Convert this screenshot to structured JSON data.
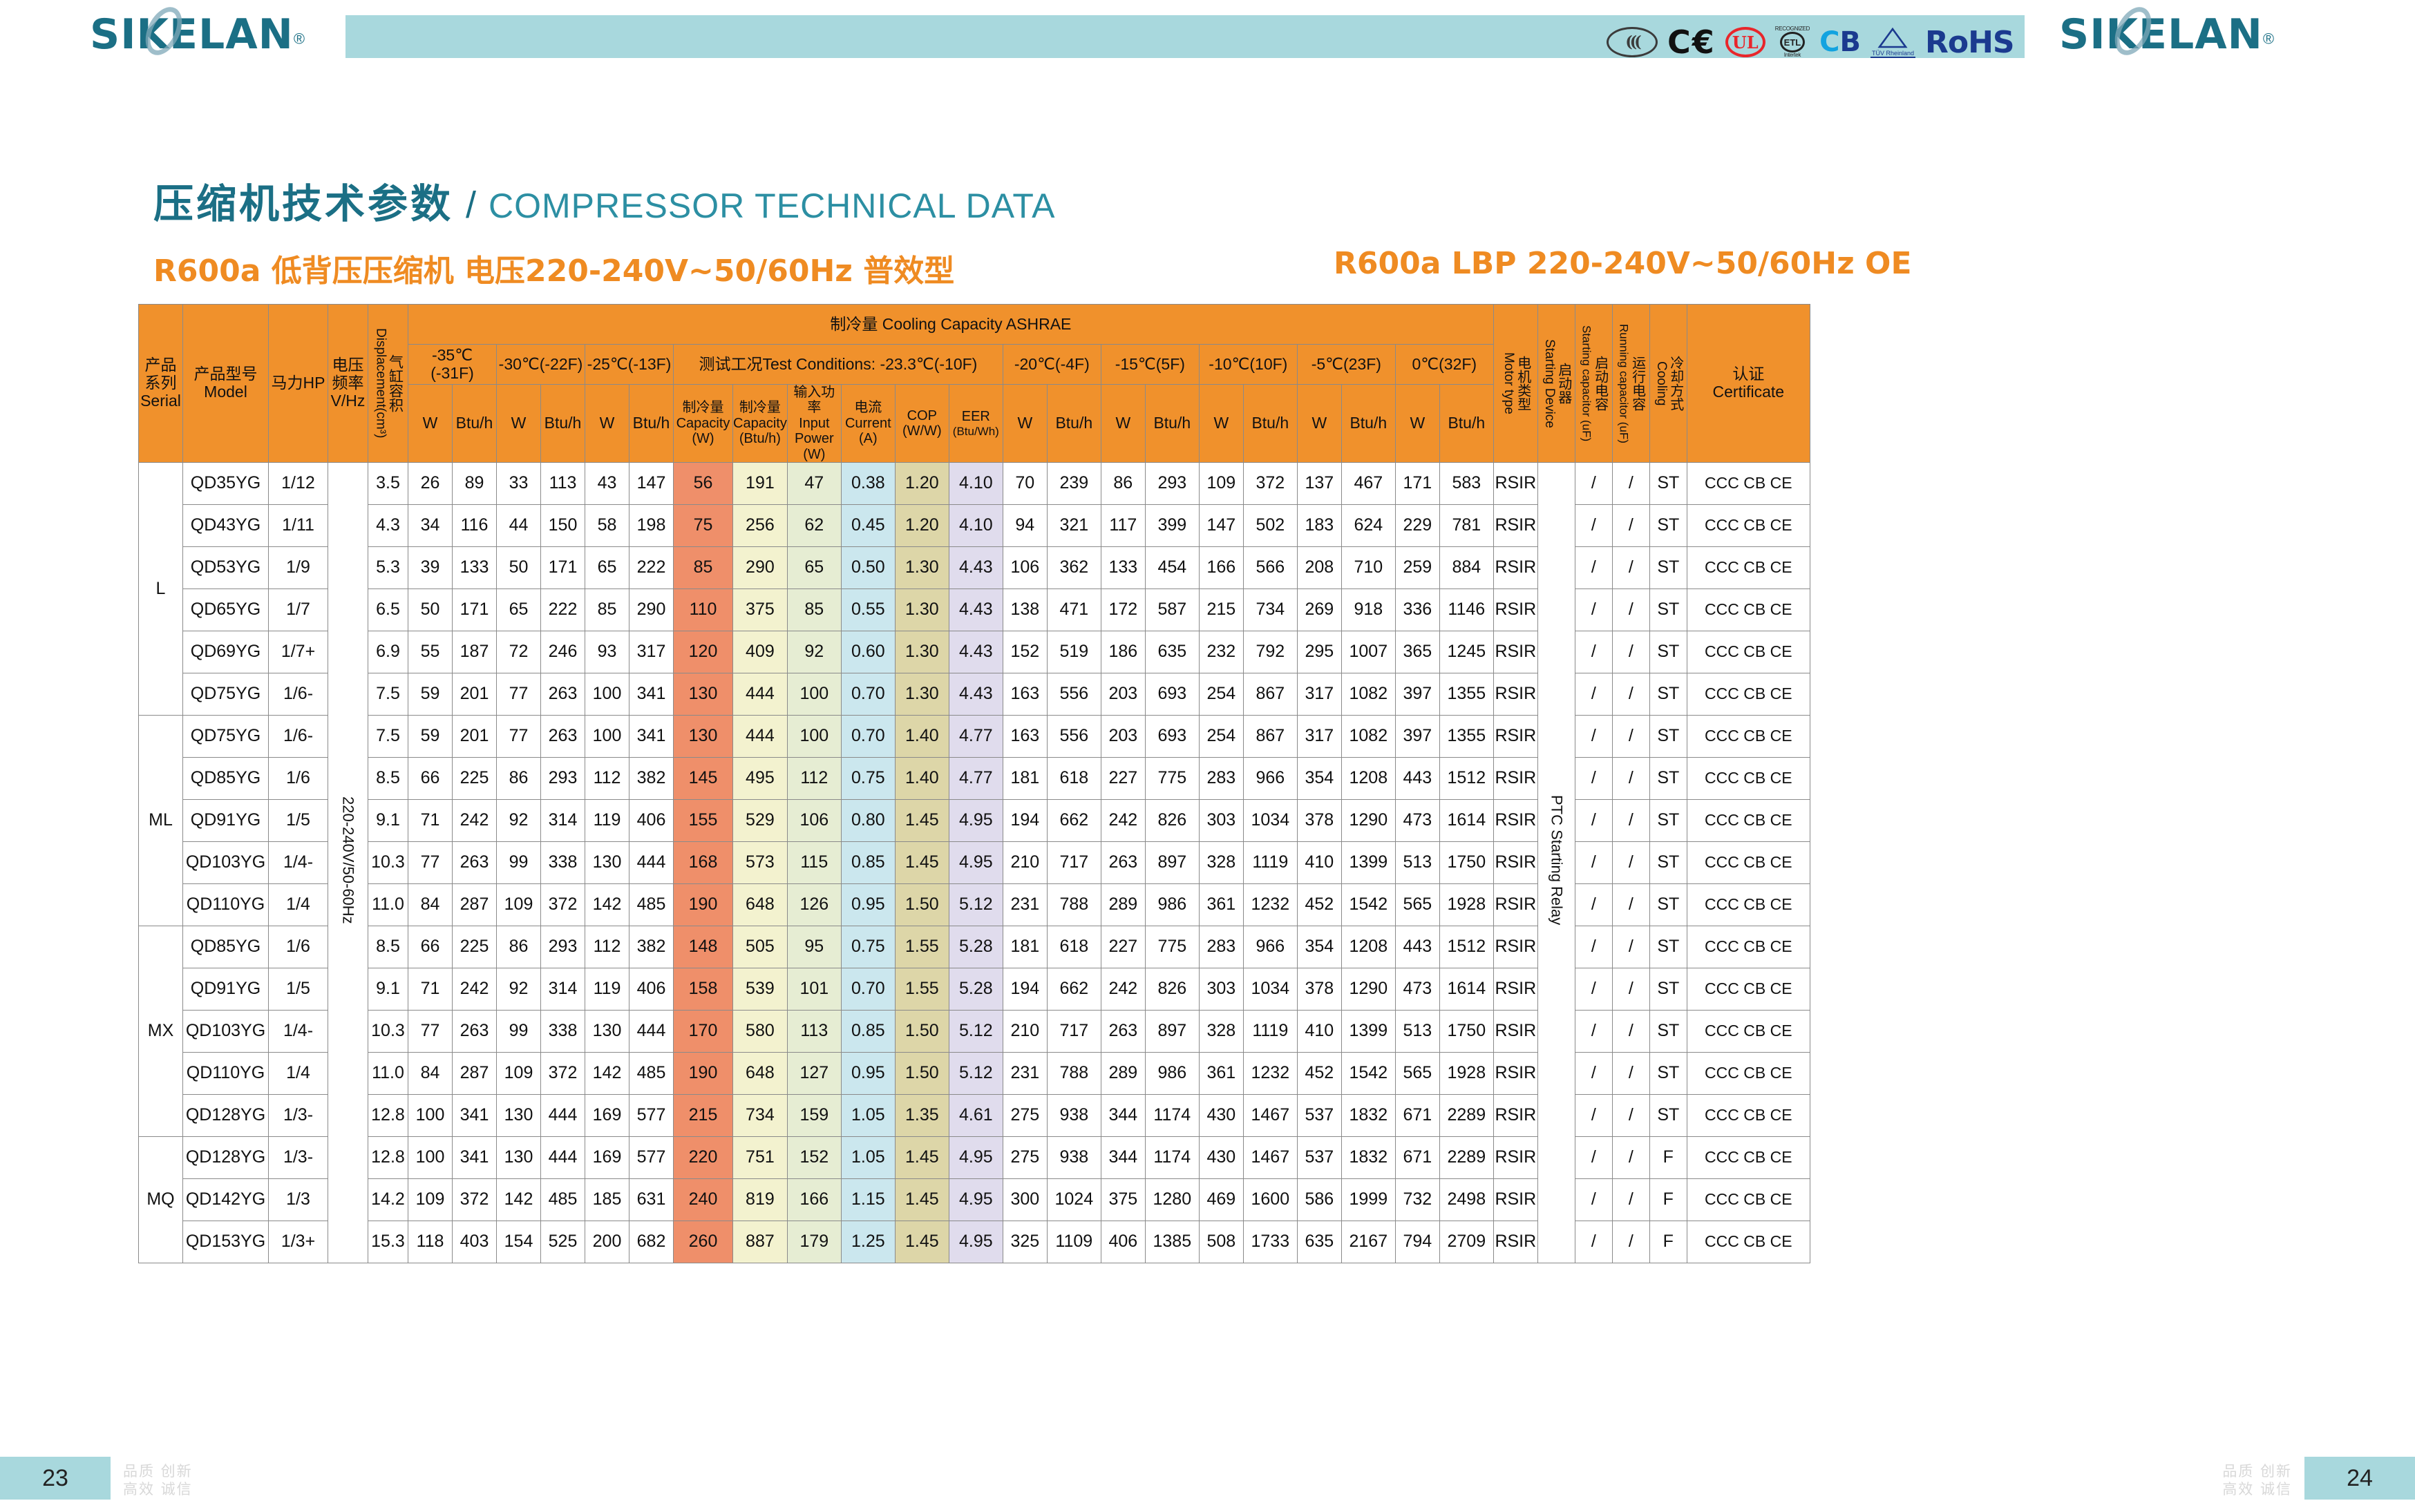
{
  "header": {
    "logo_text": "SIKELAN",
    "logo_registered": "®",
    "certs": [
      {
        "name": "ccc-mark",
        "text": "((("
      },
      {
        "name": "ce-mark",
        "text": "CE"
      },
      {
        "name": "ul-mark",
        "text": "UL"
      },
      {
        "name": "etl-mark",
        "text": "ETL",
        "top": "RECOGNIZED COMPONENT",
        "bottom": "Intertek"
      },
      {
        "name": "cb-mark",
        "text_c": "CB",
        "c": "C",
        "b": "B"
      },
      {
        "name": "tuv-mark",
        "label": "TÜV Rheinland"
      },
      {
        "name": "rohs-mark",
        "text": "RoHS"
      }
    ]
  },
  "titles": {
    "cn": "压缩机技术参数",
    "slash": "/",
    "en": "COMPRESSOR TECHNICAL DATA",
    "sub_left": "R600a    低背压压缩机    电压220-240V~50/60Hz   普效型",
    "sub_right": "R600a    LBP   220-240V~50/60Hz   OE"
  },
  "table": {
    "headers": {
      "serial": "产品\n系列\nSerial",
      "serial_cn": "产品",
      "serial_cn2": "系列",
      "serial_en": "Serial",
      "model_cn": "产品型号",
      "model_en": "Model",
      "hp": "马力HP",
      "voltage_cn1": "电压",
      "voltage_cn2": "频率",
      "voltage_en": "V/Hz",
      "displacement_en": "Displacement(cm³)",
      "displacement_cn": "气缸容积",
      "cooling_group": "制冷量    Cooling  Capacity ASHRAE",
      "temps": [
        "-35℃ (-31F)",
        "-30℃(-22F)",
        "-25℃(-13F)",
        "测试工况Test Conditions: -23.3℃(-10F)",
        "-20℃(-4F)",
        "-15℃(5F)",
        "-10℃(10F)",
        "-5℃(23F)",
        "0℃(32F)"
      ],
      "w": "W",
      "btuh": "Btu/h",
      "cap_w_cn": "制冷量",
      "cap_w_en": "Capacity",
      "cap_w_unit": "(W)",
      "cap_btu_cn": "制冷量",
      "cap_btu_en": "Capacity",
      "cap_btu_unit": "(Btu/h)",
      "power_cn": "输入功率",
      "power_en": "Input",
      "power_en2": "Power",
      "power_unit": "(W)",
      "current_cn": "电流",
      "current_en": "Current",
      "current_unit": "(A)",
      "cop": "COP",
      "cop_unit": "(W/W)",
      "eer": "EER",
      "eer_unit": "(Btu/Wh)",
      "motor_cn": "电机类型",
      "motor_en": "Motor type",
      "startdev_cn": "启动器",
      "startdev_en": "Starting Device",
      "startcap_cn": "启动电容",
      "startcap_en": "Starting capacitor (uF)",
      "runcap_cn": "运行电容",
      "runcap_en": "Running capacitor (uF)",
      "cooling_cn": "冷却方式",
      "cooling_en": "Cooling",
      "cert_cn": "认证",
      "cert_en": "Certificate"
    },
    "voltage_value": "220-240V/50-60Hz",
    "starting_device_value": "PTC Starting Relay",
    "series": [
      {
        "name": "L",
        "rowspan": 6
      },
      {
        "name": "ML",
        "rowspan": 5
      },
      {
        "name": "MX",
        "rowspan": 5
      },
      {
        "name": "MQ",
        "rowspan": 3
      }
    ],
    "rows": [
      {
        "series": "L",
        "model": "QD35YG",
        "hp": "1/12",
        "disp": "3.5",
        "t35w": "26",
        "t35b": "89",
        "t30w": "33",
        "t30b": "113",
        "t25w": "43",
        "t25b": "147",
        "capw": "56",
        "capb": "191",
        "power": "47",
        "current": "0.38",
        "cop": "1.20",
        "eer": "4.10",
        "t20w": "70",
        "t20b": "239",
        "t15w": "86",
        "t15b": "293",
        "t10w": "109",
        "t10b": "372",
        "t5w": "137",
        "t5b": "467",
        "t0w": "171",
        "t0b": "583",
        "motor": "RSIR",
        "startcap": "/",
        "runcap": "/",
        "cooling": "ST",
        "cert": "CCC CB CE"
      },
      {
        "series": "L",
        "model": "QD43YG",
        "hp": "1/11",
        "disp": "4.3",
        "t35w": "34",
        "t35b": "116",
        "t30w": "44",
        "t30b": "150",
        "t25w": "58",
        "t25b": "198",
        "capw": "75",
        "capb": "256",
        "power": "62",
        "current": "0.45",
        "cop": "1.20",
        "eer": "4.10",
        "t20w": "94",
        "t20b": "321",
        "t15w": "117",
        "t15b": "399",
        "t10w": "147",
        "t10b": "502",
        "t5w": "183",
        "t5b": "624",
        "t0w": "229",
        "t0b": "781",
        "motor": "RSIR",
        "startcap": "/",
        "runcap": "/",
        "cooling": "ST",
        "cert": "CCC CB CE"
      },
      {
        "series": "L",
        "model": "QD53YG",
        "hp": "1/9",
        "disp": "5.3",
        "t35w": "39",
        "t35b": "133",
        "t30w": "50",
        "t30b": "171",
        "t25w": "65",
        "t25b": "222",
        "capw": "85",
        "capb": "290",
        "power": "65",
        "current": "0.50",
        "cop": "1.30",
        "eer": "4.43",
        "t20w": "106",
        "t20b": "362",
        "t15w": "133",
        "t15b": "454",
        "t10w": "166",
        "t10b": "566",
        "t5w": "208",
        "t5b": "710",
        "t0w": "259",
        "t0b": "884",
        "motor": "RSIR",
        "startcap": "/",
        "runcap": "/",
        "cooling": "ST",
        "cert": "CCC CB CE"
      },
      {
        "series": "L",
        "model": "QD65YG",
        "hp": "1/7",
        "disp": "6.5",
        "t35w": "50",
        "t35b": "171",
        "t30w": "65",
        "t30b": "222",
        "t25w": "85",
        "t25b": "290",
        "capw": "110",
        "capb": "375",
        "power": "85",
        "current": "0.55",
        "cop": "1.30",
        "eer": "4.43",
        "t20w": "138",
        "t20b": "471",
        "t15w": "172",
        "t15b": "587",
        "t10w": "215",
        "t10b": "734",
        "t5w": "269",
        "t5b": "918",
        "t0w": "336",
        "t0b": "1146",
        "motor": "RSIR",
        "startcap": "/",
        "runcap": "/",
        "cooling": "ST",
        "cert": "CCC CB CE"
      },
      {
        "series": "L",
        "model": "QD69YG",
        "hp": "1/7+",
        "disp": "6.9",
        "t35w": "55",
        "t35b": "187",
        "t30w": "72",
        "t30b": "246",
        "t25w": "93",
        "t25b": "317",
        "capw": "120",
        "capb": "409",
        "power": "92",
        "current": "0.60",
        "cop": "1.30",
        "eer": "4.43",
        "t20w": "152",
        "t20b": "519",
        "t15w": "186",
        "t15b": "635",
        "t10w": "232",
        "t10b": "792",
        "t5w": "295",
        "t5b": "1007",
        "t0w": "365",
        "t0b": "1245",
        "motor": "RSIR",
        "startcap": "/",
        "runcap": "/",
        "cooling": "ST",
        "cert": "CCC CB CE"
      },
      {
        "series": "L",
        "model": "QD75YG",
        "hp": "1/6-",
        "disp": "7.5",
        "t35w": "59",
        "t35b": "201",
        "t30w": "77",
        "t30b": "263",
        "t25w": "100",
        "t25b": "341",
        "capw": "130",
        "capb": "444",
        "power": "100",
        "current": "0.70",
        "cop": "1.30",
        "eer": "4.43",
        "t20w": "163",
        "t20b": "556",
        "t15w": "203",
        "t15b": "693",
        "t10w": "254",
        "t10b": "867",
        "t5w": "317",
        "t5b": "1082",
        "t0w": "397",
        "t0b": "1355",
        "motor": "RSIR",
        "startcap": "/",
        "runcap": "/",
        "cooling": "ST",
        "cert": "CCC CB CE"
      },
      {
        "series": "ML",
        "model": "QD75YG",
        "hp": "1/6-",
        "disp": "7.5",
        "t35w": "59",
        "t35b": "201",
        "t30w": "77",
        "t30b": "263",
        "t25w": "100",
        "t25b": "341",
        "capw": "130",
        "capb": "444",
        "power": "100",
        "current": "0.70",
        "cop": "1.40",
        "eer": "4.77",
        "t20w": "163",
        "t20b": "556",
        "t15w": "203",
        "t15b": "693",
        "t10w": "254",
        "t10b": "867",
        "t5w": "317",
        "t5b": "1082",
        "t0w": "397",
        "t0b": "1355",
        "motor": "RSIR",
        "startcap": "/",
        "runcap": "/",
        "cooling": "ST",
        "cert": "CCC CB CE"
      },
      {
        "series": "ML",
        "model": "QD85YG",
        "hp": "1/6",
        "disp": "8.5",
        "t35w": "66",
        "t35b": "225",
        "t30w": "86",
        "t30b": "293",
        "t25w": "112",
        "t25b": "382",
        "capw": "145",
        "capb": "495",
        "power": "112",
        "current": "0.75",
        "cop": "1.40",
        "eer": "4.77",
        "t20w": "181",
        "t20b": "618",
        "t15w": "227",
        "t15b": "775",
        "t10w": "283",
        "t10b": "966",
        "t5w": "354",
        "t5b": "1208",
        "t0w": "443",
        "t0b": "1512",
        "motor": "RSIR",
        "startcap": "/",
        "runcap": "/",
        "cooling": "ST",
        "cert": "CCC CB CE"
      },
      {
        "series": "ML",
        "model": "QD91YG",
        "hp": "1/5",
        "disp": "9.1",
        "t35w": "71",
        "t35b": "242",
        "t30w": "92",
        "t30b": "314",
        "t25w": "119",
        "t25b": "406",
        "capw": "155",
        "capb": "529",
        "power": "106",
        "current": "0.80",
        "cop": "1.45",
        "eer": "4.95",
        "t20w": "194",
        "t20b": "662",
        "t15w": "242",
        "t15b": "826",
        "t10w": "303",
        "t10b": "1034",
        "t5w": "378",
        "t5b": "1290",
        "t0w": "473",
        "t0b": "1614",
        "motor": "RSIR",
        "startcap": "/",
        "runcap": "/",
        "cooling": "ST",
        "cert": "CCC CB CE"
      },
      {
        "series": "ML",
        "model": "QD103YG",
        "hp": "1/4-",
        "disp": "10.3",
        "t35w": "77",
        "t35b": "263",
        "t30w": "99",
        "t30b": "338",
        "t25w": "130",
        "t25b": "444",
        "capw": "168",
        "capb": "573",
        "power": "115",
        "current": "0.85",
        "cop": "1.45",
        "eer": "4.95",
        "t20w": "210",
        "t20b": "717",
        "t15w": "263",
        "t15b": "897",
        "t10w": "328",
        "t10b": "1119",
        "t5w": "410",
        "t5b": "1399",
        "t0w": "513",
        "t0b": "1750",
        "motor": "RSIR",
        "startcap": "/",
        "runcap": "/",
        "cooling": "ST",
        "cert": "CCC CB CE"
      },
      {
        "series": "ML",
        "model": "QD110YG",
        "hp": "1/4",
        "disp": "11.0",
        "t35w": "84",
        "t35b": "287",
        "t30w": "109",
        "t30b": "372",
        "t25w": "142",
        "t25b": "485",
        "capw": "190",
        "capb": "648",
        "power": "126",
        "current": "0.95",
        "cop": "1.50",
        "eer": "5.12",
        "t20w": "231",
        "t20b": "788",
        "t15w": "289",
        "t15b": "986",
        "t10w": "361",
        "t10b": "1232",
        "t5w": "452",
        "t5b": "1542",
        "t0w": "565",
        "t0b": "1928",
        "motor": "RSIR",
        "startcap": "/",
        "runcap": "/",
        "cooling": "ST",
        "cert": "CCC CB CE"
      },
      {
        "series": "MX",
        "model": "QD85YG",
        "hp": "1/6",
        "disp": "8.5",
        "t35w": "66",
        "t35b": "225",
        "t30w": "86",
        "t30b": "293",
        "t25w": "112",
        "t25b": "382",
        "capw": "148",
        "capb": "505",
        "power": "95",
        "current": "0.75",
        "cop": "1.55",
        "eer": "5.28",
        "t20w": "181",
        "t20b": "618",
        "t15w": "227",
        "t15b": "775",
        "t10w": "283",
        "t10b": "966",
        "t5w": "354",
        "t5b": "1208",
        "t0w": "443",
        "t0b": "1512",
        "motor": "RSIR",
        "startcap": "/",
        "runcap": "/",
        "cooling": "ST",
        "cert": "CCC CB CE"
      },
      {
        "series": "MX",
        "model": "QD91YG",
        "hp": "1/5",
        "disp": "9.1",
        "t35w": "71",
        "t35b": "242",
        "t30w": "92",
        "t30b": "314",
        "t25w": "119",
        "t25b": "406",
        "capw": "158",
        "capb": "539",
        "power": "101",
        "current": "0.70",
        "cop": "1.55",
        "eer": "5.28",
        "t20w": "194",
        "t20b": "662",
        "t15w": "242",
        "t15b": "826",
        "t10w": "303",
        "t10b": "1034",
        "t5w": "378",
        "t5b": "1290",
        "t0w": "473",
        "t0b": "1614",
        "motor": "RSIR",
        "startcap": "/",
        "runcap": "/",
        "cooling": "ST",
        "cert": "CCC CB CE"
      },
      {
        "series": "MX",
        "model": "QD103YG",
        "hp": "1/4-",
        "disp": "10.3",
        "t35w": "77",
        "t35b": "263",
        "t30w": "99",
        "t30b": "338",
        "t25w": "130",
        "t25b": "444",
        "capw": "170",
        "capb": "580",
        "power": "113",
        "current": "0.85",
        "cop": "1.50",
        "eer": "5.12",
        "t20w": "210",
        "t20b": "717",
        "t15w": "263",
        "t15b": "897",
        "t10w": "328",
        "t10b": "1119",
        "t5w": "410",
        "t5b": "1399",
        "t0w": "513",
        "t0b": "1750",
        "motor": "RSIR",
        "startcap": "/",
        "runcap": "/",
        "cooling": "ST",
        "cert": "CCC CB CE"
      },
      {
        "series": "MX",
        "model": "QD110YG",
        "hp": "1/4",
        "disp": "11.0",
        "t35w": "84",
        "t35b": "287",
        "t30w": "109",
        "t30b": "372",
        "t25w": "142",
        "t25b": "485",
        "capw": "190",
        "capb": "648",
        "power": "127",
        "current": "0.95",
        "cop": "1.50",
        "eer": "5.12",
        "t20w": "231",
        "t20b": "788",
        "t15w": "289",
        "t15b": "986",
        "t10w": "361",
        "t10b": "1232",
        "t5w": "452",
        "t5b": "1542",
        "t0w": "565",
        "t0b": "1928",
        "motor": "RSIR",
        "startcap": "/",
        "runcap": "/",
        "cooling": "ST",
        "cert": "CCC CB CE"
      },
      {
        "series": "MX",
        "model": "QD128YG",
        "hp": "1/3-",
        "disp": "12.8",
        "t35w": "100",
        "t35b": "341",
        "t30w": "130",
        "t30b": "444",
        "t25w": "169",
        "t25b": "577",
        "capw": "215",
        "capb": "734",
        "power": "159",
        "current": "1.05",
        "cop": "1.35",
        "eer": "4.61",
        "t20w": "275",
        "t20b": "938",
        "t15w": "344",
        "t15b": "1174",
        "t10w": "430",
        "t10b": "1467",
        "t5w": "537",
        "t5b": "1832",
        "t0w": "671",
        "t0b": "2289",
        "motor": "RSIR",
        "startcap": "/",
        "runcap": "/",
        "cooling": "ST",
        "cert": "CCC CB CE"
      },
      {
        "series": "MQ",
        "model": "QD128YG",
        "hp": "1/3-",
        "disp": "12.8",
        "t35w": "100",
        "t35b": "341",
        "t30w": "130",
        "t30b": "444",
        "t25w": "169",
        "t25b": "577",
        "capw": "220",
        "capb": "751",
        "power": "152",
        "current": "1.05",
        "cop": "1.45",
        "eer": "4.95",
        "t20w": "275",
        "t20b": "938",
        "t15w": "344",
        "t15b": "1174",
        "t10w": "430",
        "t10b": "1467",
        "t5w": "537",
        "t5b": "1832",
        "t0w": "671",
        "t0b": "2289",
        "motor": "RSIR",
        "startcap": "/",
        "runcap": "/",
        "cooling": "F",
        "cert": "CCC CB CE"
      },
      {
        "series": "MQ",
        "model": "QD142YG",
        "hp": "1/3",
        "disp": "14.2",
        "t35w": "109",
        "t35b": "372",
        "t30w": "142",
        "t30b": "485",
        "t25w": "185",
        "t25b": "631",
        "capw": "240",
        "capb": "819",
        "power": "166",
        "current": "1.15",
        "cop": "1.45",
        "eer": "4.95",
        "t20w": "300",
        "t20b": "1024",
        "t15w": "375",
        "t15b": "1280",
        "t10w": "469",
        "t10b": "1600",
        "t5w": "586",
        "t5b": "1999",
        "t0w": "732",
        "t0b": "2498",
        "motor": "RSIR",
        "startcap": "/",
        "runcap": "/",
        "cooling": "F",
        "cert": "CCC CB CE"
      },
      {
        "series": "MQ",
        "model": "QD153YG",
        "hp": "1/3+",
        "disp": "15.3",
        "t35w": "118",
        "t35b": "403",
        "t30w": "154",
        "t30b": "525",
        "t25w": "200",
        "t25b": "682",
        "capw": "260",
        "capb": "887",
        "power": "179",
        "current": "1.25",
        "cop": "1.45",
        "eer": "4.95",
        "t20w": "325",
        "t20b": "1109",
        "t15w": "406",
        "t15b": "1385",
        "t10w": "508",
        "t10b": "1733",
        "t5w": "635",
        "t5b": "2167",
        "t0w": "794",
        "t0b": "2709",
        "motor": "RSIR",
        "startcap": "/",
        "runcap": "/",
        "cooling": "F",
        "cert": "CCC CB CE"
      }
    ]
  },
  "footer": {
    "page_left": "23",
    "page_right": "24",
    "slogan_line1": "品质 创新",
    "slogan_line2": "高效 诚信"
  },
  "colors": {
    "brand_teal": "#1b6f85",
    "accent_orange": "#ef8b22",
    "header_orange": "#f0912c",
    "band_teal": "#a8d8dd",
    "col_orange": "#ef8f6a",
    "col_cream": "#f3f2cf",
    "col_green": "#e6edd3",
    "col_blue": "#cbe7ee",
    "col_khaki": "#ddd6a8",
    "col_lilac": "#e0dced"
  }
}
